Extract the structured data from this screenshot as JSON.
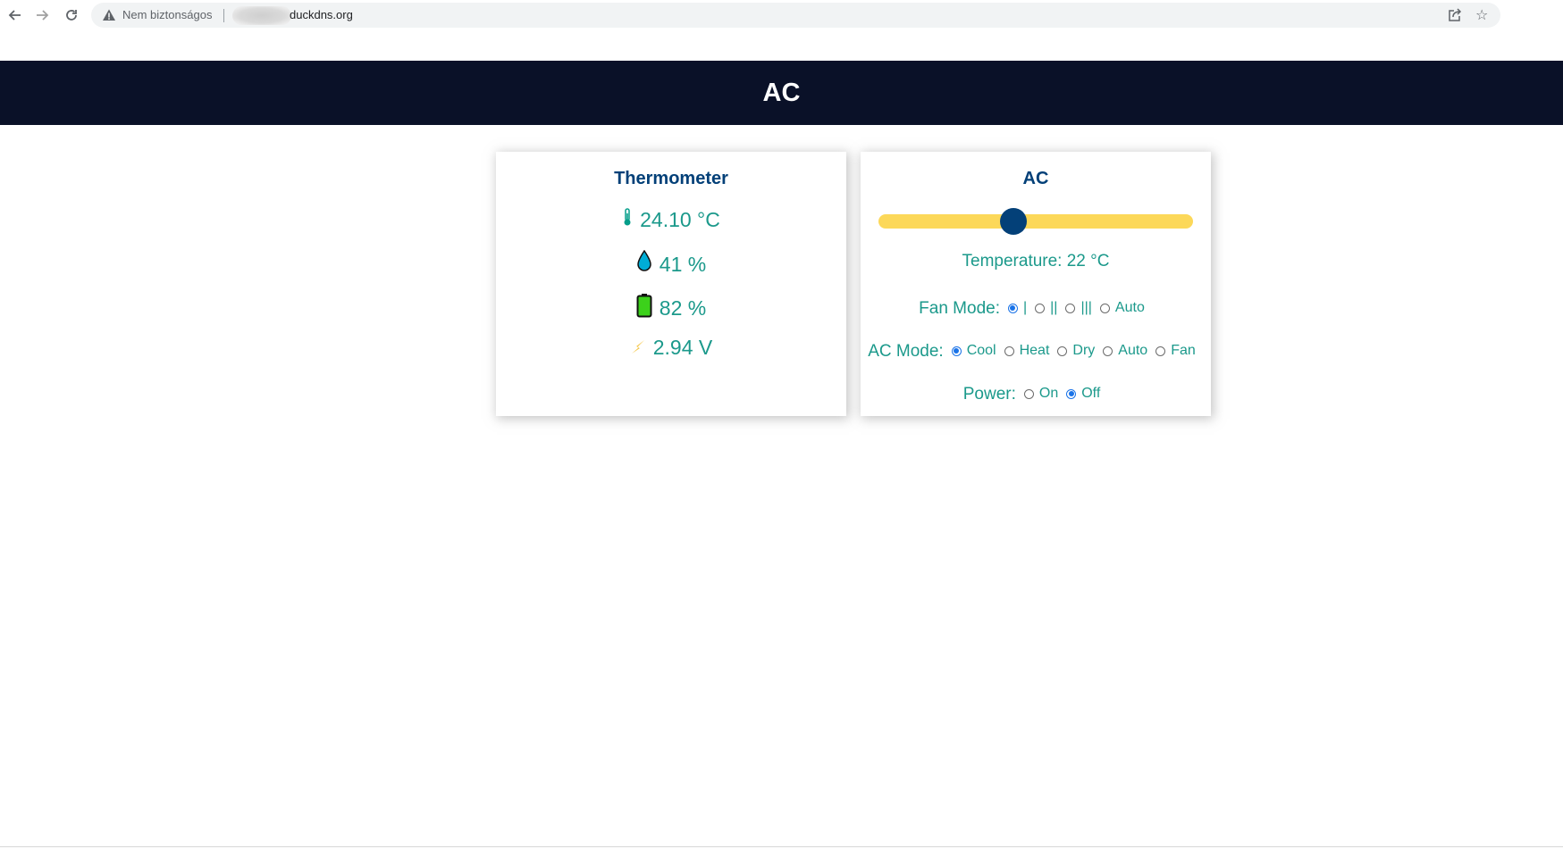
{
  "browser": {
    "not_secure_label": "Nem biztonságos",
    "url_domain": "duckdns.org"
  },
  "header": {
    "title": "AC"
  },
  "thermometer": {
    "title": "Thermometer",
    "temperature": "24.10 °C",
    "humidity": "41 %",
    "battery": "82 %",
    "voltage": "2.94 V",
    "icon_colors": {
      "thermometer": "#059e8a",
      "humidity": "#00add6",
      "battery": "#3cd11b",
      "voltage": "#f5c542"
    }
  },
  "ac": {
    "title": "AC",
    "slider": {
      "value": 22,
      "min": 16,
      "max": 30
    },
    "temperature_text": "Temperature: 22 °C",
    "fan_mode": {
      "label": "Fan Mode:",
      "options": [
        "|",
        "||",
        "|||",
        "Auto"
      ],
      "selected": "|"
    },
    "ac_mode": {
      "label": "AC Mode:",
      "options": [
        "Cool",
        "Heat",
        "Dry",
        "Auto",
        "Fan"
      ],
      "selected": "Cool"
    },
    "power": {
      "label": "Power:",
      "options": [
        "On",
        "Off"
      ],
      "selected": "Off"
    }
  },
  "colors": {
    "header_bg": "#0a1128",
    "title_color": "#034078",
    "text_color": "#1b998b",
    "slider_track": "#fcd859",
    "slider_thumb": "#034078"
  }
}
